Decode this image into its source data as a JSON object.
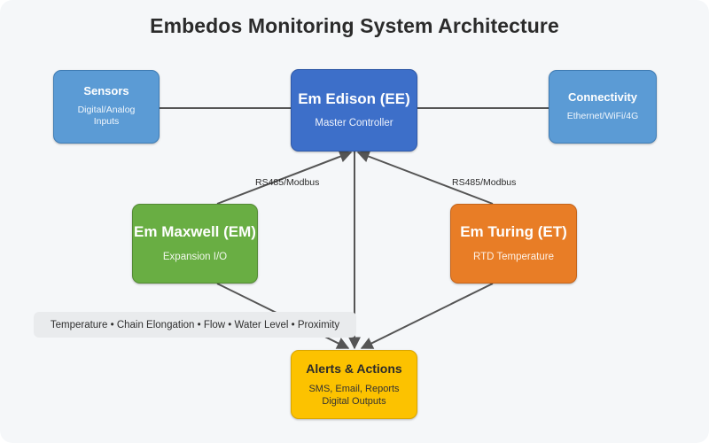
{
  "diagram": {
    "title": "Embedos Monitoring System Architecture",
    "background_color": "#f5f7f9"
  },
  "nodes": {
    "sensors": {
      "title": "Sensors",
      "subtitle": "Digital/Analog\nInputs",
      "color": "#5b9bd5"
    },
    "edison": {
      "title": "Em Edison (EE)",
      "subtitle": "Master Controller",
      "color": "#3d6fc9"
    },
    "connectivity": {
      "title": "Connectivity",
      "subtitle": "Ethernet/WiFi/4G",
      "color": "#5b9bd5"
    },
    "maxwell": {
      "title": "Em Maxwell (EM)",
      "subtitle": "Expansion I/O",
      "color": "#69ae43"
    },
    "turing": {
      "title": "Em Turing (ET)",
      "subtitle": "RTD Temperature",
      "color": "#e87d26"
    },
    "alerts": {
      "title": "Alerts & Actions",
      "subtitle": "SMS, Email, Reports\nDigital Outputs",
      "color": "#fcc200"
    }
  },
  "sensor_list": {
    "text": "Temperature • Chain Elongation • Flow • Water Level • Proximity",
    "items": [
      "Temperature",
      "Chain Elongation",
      "Flow",
      "Water Level",
      "Proximity"
    ],
    "separator": "•"
  },
  "edges": {
    "bus_left_label": "RS485/Modbus",
    "bus_right_label": "RS485/Modbus",
    "line_color": "#555555",
    "connections": [
      {
        "from": "sensors",
        "to": "edison",
        "label": ""
      },
      {
        "from": "edison",
        "to": "connectivity",
        "label": ""
      },
      {
        "from": "edison",
        "to": "maxwell",
        "label": "RS485/Modbus"
      },
      {
        "from": "edison",
        "to": "turing",
        "label": "RS485/Modbus"
      },
      {
        "from": "edison",
        "to": "alerts",
        "label": ""
      },
      {
        "from": "maxwell",
        "to": "alerts",
        "label": ""
      },
      {
        "from": "turing",
        "to": "alerts",
        "label": ""
      }
    ]
  }
}
